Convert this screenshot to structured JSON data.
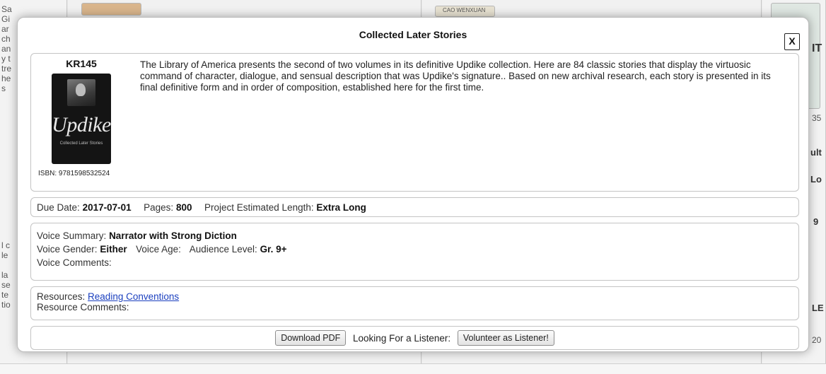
{
  "modal": {
    "title": "Collected Later Stories",
    "close_label": "X"
  },
  "book": {
    "code": "KR145",
    "cover_author": "Updike",
    "cover_subtitle": "Collected Later Stories",
    "isbn": "ISBN: 9781598532524",
    "description": "The Library of America presents the second of two volumes in its definitive Updike collection. Here are 84 classic stories that display the virtuosic command of character, dialogue, and sensual description that was Updike's signature.. Based on new archival research, each story is presented in its final definitive form and in order of composition, established here for the first time."
  },
  "details": {
    "due_label": "Due Date:",
    "due_value": "2017-07-01",
    "pages_label": "Pages:",
    "pages_value": "800",
    "length_label": "Project Estimated Length:",
    "length_value": "Extra Long"
  },
  "voice": {
    "summary_label": "Voice Summary:",
    "summary_value": "Narrator with Strong Diction",
    "gender_label": "Voice Gender:",
    "gender_value": "Either",
    "age_label": "Voice Age:",
    "audience_label": "Audience Level:",
    "audience_value": "Gr. 9+",
    "comments_label": "Voice Comments:"
  },
  "resources": {
    "label": "Resources:",
    "link_text": "Reading Conventions",
    "comments_label": "Resource Comments:"
  },
  "actions": {
    "download_label": "Download PDF",
    "listener_label": "Looking For a Listener:",
    "volunteer_label": "Volunteer as Listener!"
  },
  "background": {
    "thumb_label": "CAO WENXUAN",
    "right_snippets": [
      "IT",
      "35",
      "ult",
      "Lo",
      "9",
      "LE",
      "20"
    ],
    "left_snippets": [
      "Sa",
      "Gi",
      "ar",
      "ch",
      "an",
      "y t",
      "tre",
      "he",
      "s"
    ],
    "left_lower": [
      "l c",
      "le",
      "la",
      "se",
      "te",
      "tio"
    ]
  }
}
